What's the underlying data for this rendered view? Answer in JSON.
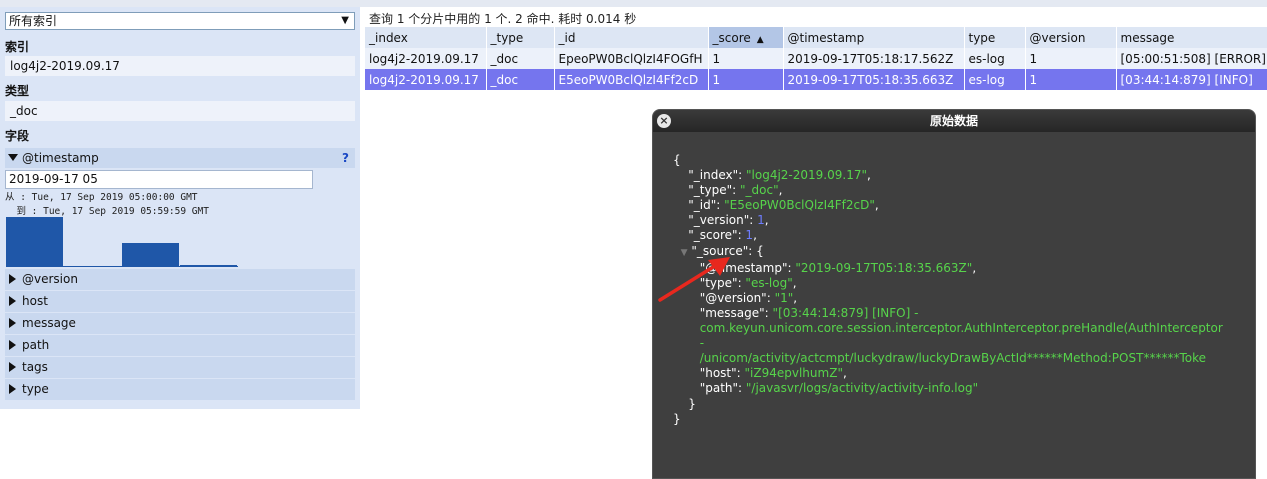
{
  "sidebar": {
    "index_select": "所有索引",
    "index_label": "索引",
    "index_value": "log4j2-2019.09.17",
    "type_label": "类型",
    "type_value": "_doc",
    "fields_label": "字段",
    "open_field": {
      "name": "@timestamp",
      "help": "?",
      "input_value": "2019-09-17 05",
      "from_text": "从 : Tue, 17 Sep 2019 05:00:00 GMT",
      "to_text": "  到 : Tue, 17 Sep 2019 05:59:59 GMT"
    },
    "histogram": [
      1,
      0,
      0.48,
      0.04
    ],
    "fields": [
      "@version",
      "host",
      "message",
      "path",
      "tags",
      "type"
    ]
  },
  "results": {
    "status": "查询 1 个分片中用的 1 个. 2 命中. 耗时 0.014 秒",
    "sort_indicator": "▲",
    "columns": [
      "_index",
      "_type",
      "_id",
      "_score",
      "@timestamp",
      "type",
      "@version",
      "message"
    ],
    "rows": [
      [
        "log4j2-2019.09.17",
        "_doc",
        "EpeoPW0BclQlzI4FOGfH",
        "1",
        "2019-09-17T05:18:17.562Z",
        "es-log",
        "1",
        "[05:00:51:508] [ERROR]"
      ],
      [
        "log4j2-2019.09.17",
        "_doc",
        "E5eoPW0BclQlzI4Ff2cD",
        "1",
        "2019-09-17T05:18:35.663Z",
        "es-log",
        "1",
        "[03:44:14:879] [INFO]"
      ]
    ]
  },
  "popup": {
    "title": "原始数据",
    "close": "×",
    "fold_marker": "▼",
    "doc": {
      "_index": "log4j2-2019.09.17",
      "_type": "_doc",
      "_id": "E5eoPW0BclQlzI4Ff2cD",
      "_version": "1",
      "_score": "1",
      "source": {
        "timestamp": "2019-09-17T05:18:35.663Z",
        "type": "es-log",
        "version": "1",
        "message_l1": "[03:44:14:879] [INFO] -",
        "message_l2": "com.keyun.unicom.core.session.interceptor.AuthInterceptor.preHandle(AuthInterceptor",
        "message_l3": "-",
        "message_l4": "/unicom/activity/actcmpt/luckydraw/luckyDrawByActId******Method:POST******Toke",
        "host": "iZ94epvlhumZ",
        "path": "/javasvr/logs/activity/activity-info.log"
      }
    }
  },
  "colors": {
    "sidebar_bg": "#dbe5f6",
    "selected_row": "#7575ee",
    "histogram_bar": "#1f57a8",
    "json_string": "#57d44b",
    "json_number": "#6e7dff",
    "annotation_arrow": "#e8281e"
  }
}
